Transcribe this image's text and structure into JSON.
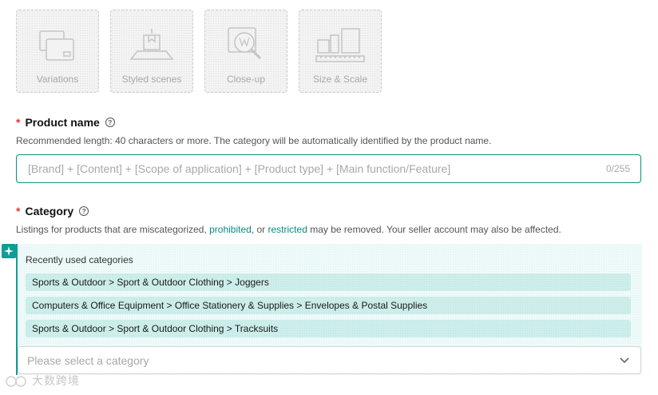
{
  "image_tiles": [
    {
      "label": "Variations",
      "icon": "variations-icon"
    },
    {
      "label": "Styled scenes",
      "icon": "styled-scenes-icon"
    },
    {
      "label": "Close-up",
      "icon": "close-up-icon"
    },
    {
      "label": "Size & Scale",
      "icon": "size-scale-icon"
    }
  ],
  "product_name": {
    "required_mark": "*",
    "label": "Product name",
    "help_glyph": "?",
    "hint": "Recommended length: 40 characters or more. The category will be automatically identified by the product name.",
    "value": "",
    "placeholder": "[Brand] + [Content] + [Scope of application] + [Product type] + [Main function/Feature]",
    "counter": "0/255"
  },
  "category": {
    "required_mark": "*",
    "label": "Category",
    "help_glyph": "?",
    "hint_part1": "Listings for products that are miscategorized, ",
    "hint_link1": "prohibited",
    "hint_part2": ", or ",
    "hint_link2": "restricted",
    "hint_part3": " may be removed. Your seller account may also be affected.",
    "recent_title": "Recently used categories",
    "recent": [
      "Sports & Outdoor > Sport & Outdoor Clothing > Joggers",
      "Computers & Office Equipment > Office Stationery & Supplies > Envelopes & Postal Supplies",
      "Sports & Outdoor > Sport & Outdoor Clothing > Tracksuits"
    ],
    "select_placeholder": "Please select a category"
  },
  "watermark": {
    "text": "大数跨境"
  },
  "colors": {
    "accent": "#0a8f87",
    "required": "#e4393c",
    "panel_bg": "#eefaf9"
  }
}
